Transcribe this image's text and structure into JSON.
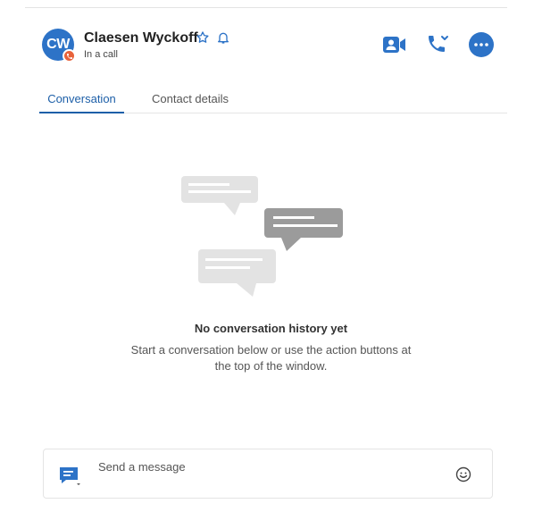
{
  "contact": {
    "initials": "CW",
    "name": "Claesen Wyckoff",
    "status": "In a call"
  },
  "header_icons": {
    "favorite": "star-icon",
    "notifications": "bell-icon",
    "video": "video-call-icon",
    "call": "phone-call-icon",
    "more": "more-icon"
  },
  "tabs": [
    {
      "label": "Conversation",
      "active": true
    },
    {
      "label": "Contact details",
      "active": false
    }
  ],
  "empty_state": {
    "title": "No conversation history yet",
    "description_line1": "Start a conversation below or use the action buttons at",
    "description_line2": "the top of the window."
  },
  "composer": {
    "placeholder": "Send a message"
  },
  "colors": {
    "brand": "#2d73c7",
    "tab_active": "#1d5fa8",
    "presence_in_call": "#e8623a"
  }
}
